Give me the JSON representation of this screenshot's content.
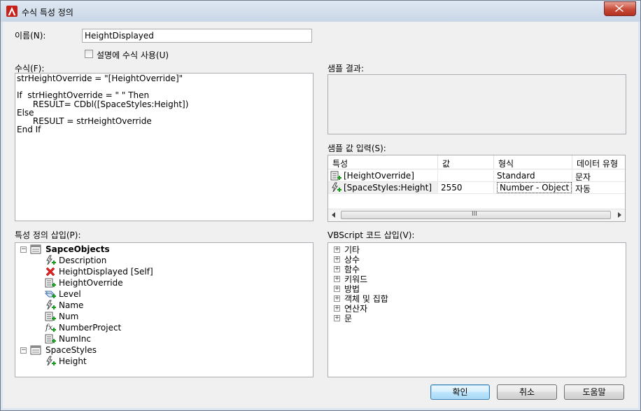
{
  "window": {
    "title": "수식 특성 정의",
    "close_icon": "close-icon"
  },
  "name_field": {
    "label": "이름(N):",
    "value": "HeightDisplayed"
  },
  "use_formula_checkbox": {
    "label": "설명에 수식 사용(U)",
    "checked": false
  },
  "formula": {
    "label": "수식(F):",
    "text": "strHeightOverride = \"[HeightOverride]\"\n\nIf  strHieghtOverride = \" \" Then\n      RESULT= CDbl([SpaceStyles:Height])\nElse\n      RESULT = strHeightOverride\nEnd If"
  },
  "sample_result": {
    "label": "샘플 결과:",
    "value": ""
  },
  "sample_input": {
    "label": "샘플 값 입력(S):",
    "columns": [
      "특성",
      "값",
      "형식",
      "데이터 유형"
    ],
    "rows": [
      {
        "property": "[HeightOverride]",
        "value": "",
        "format": "Standard",
        "datatype": "문자",
        "icon": "property-icon"
      },
      {
        "property": "[SpaceStyles:Height]",
        "value": "2550",
        "format": "Number - Object",
        "datatype": "자동",
        "icon": "automatic-property-icon"
      }
    ],
    "scroll_thumb_glyph": "III"
  },
  "property_tree": {
    "label": "특성 정의 삽입(P):",
    "groups": [
      {
        "name": "SapceObjects",
        "bold": true,
        "items": [
          {
            "label": "Description",
            "icon": "automatic-property-icon"
          },
          {
            "label": "HeightDisplayed [Self]",
            "icon": "red-x-icon"
          },
          {
            "label": "HeightOverride",
            "icon": "property-icon"
          },
          {
            "label": "Level",
            "icon": "level-icon"
          },
          {
            "label": "Name",
            "icon": "automatic-property-icon"
          },
          {
            "label": "Num",
            "icon": "property-icon"
          },
          {
            "label": "NumberProject",
            "icon": "formula-icon"
          },
          {
            "label": "NumInc",
            "icon": "property-icon"
          }
        ]
      },
      {
        "name": "SpaceStyles",
        "bold": false,
        "items": [
          {
            "label": "Height",
            "icon": "automatic-property-icon"
          }
        ]
      }
    ]
  },
  "vbscript_tree": {
    "label": "VBScript 코드 삽입(V):",
    "items": [
      "기타",
      "상수",
      "함수",
      "키워드",
      "방법",
      "객체 및 집합",
      "연산자",
      "문"
    ]
  },
  "buttons": {
    "ok": "확인",
    "cancel": "취소",
    "help": "도움말"
  },
  "colors": {
    "title_bar": "#c9d6e6",
    "close_button": "#c74a37",
    "dialog_background": "#f0f0f0",
    "default_button": "#bee6fd"
  }
}
